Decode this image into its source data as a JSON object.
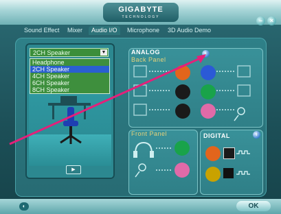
{
  "header": {
    "brand": "GIGABYTE",
    "brand_sub": "TECHNOLOGY"
  },
  "tabs": [
    {
      "label": "Sound Effect"
    },
    {
      "label": "Mixer"
    },
    {
      "label": "Audio I/O"
    },
    {
      "label": "Microphone"
    },
    {
      "label": "3D Audio Demo"
    }
  ],
  "speaker_select": {
    "value": "2CH Speaker",
    "options": [
      "Headphone",
      "2CH Speaker",
      "4CH Speaker",
      "6CH Speaker",
      "8CH Speaker"
    ],
    "selected_index": 1
  },
  "analog": {
    "title": "ANALOG",
    "back_panel": "Back Panel"
  },
  "front_panel": {
    "title": "Front Panel"
  },
  "digital": {
    "title": "DIGITAL"
  },
  "footer": {
    "ok_label": "OK"
  },
  "colors": {
    "jack_orange": "#e2651c",
    "jack_black": "#1a1a1a",
    "jack_blue": "#2b5ad6",
    "jack_green": "#19a34a",
    "jack_pink": "#e06aa8",
    "accent_arrow": "#e4207a"
  }
}
